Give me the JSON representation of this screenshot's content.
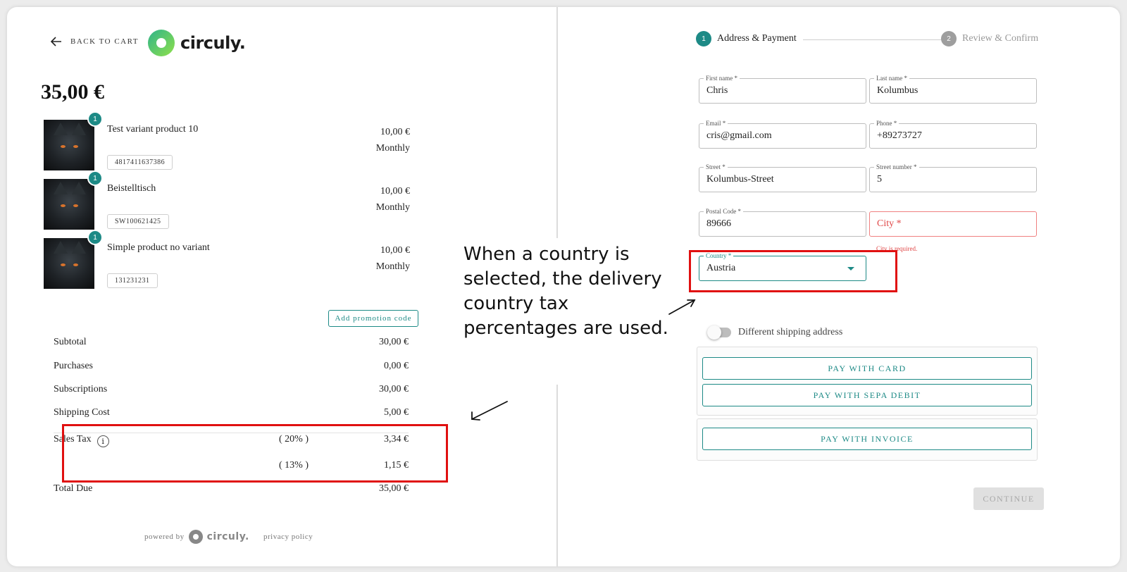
{
  "colors": {
    "accent": "#1d8a86",
    "error": "#e04848",
    "highlight": "#e01010"
  },
  "header": {
    "back_label": "BACK TO CART",
    "logo_text": "circuly."
  },
  "cart": {
    "total": "35,00 €",
    "items": [
      {
        "qty": "1",
        "name": "Test variant product 10",
        "sku": "4817411637386",
        "price": "10,00 €",
        "interval": "Monthly"
      },
      {
        "qty": "1",
        "name": "Beistelltisch",
        "sku": "SW100621425",
        "price": "10,00 €",
        "interval": "Monthly"
      },
      {
        "qty": "1",
        "name": "Simple product no variant",
        "sku": "131231231",
        "price": "10,00 €",
        "interval": "Monthly"
      }
    ],
    "promo_label": "Add promotion code"
  },
  "summary": {
    "subtotal": {
      "label": "Subtotal",
      "value": "30,00 €"
    },
    "purchases": {
      "label": "Purchases",
      "value": "0,00 €"
    },
    "subscriptions": {
      "label": "Subscriptions",
      "value": "30,00 €"
    },
    "shipping": {
      "label": "Shipping Cost",
      "value": "5,00 €"
    },
    "sales_tax": {
      "label": "Sales Tax",
      "info_icon": "i",
      "rates": [
        {
          "pct": "( 20% )",
          "value": "3,34 €"
        },
        {
          "pct": "( 13% )",
          "value": "1,15 €"
        }
      ]
    },
    "total_due": {
      "label": "Total Due",
      "value": "35,00 €"
    }
  },
  "footer": {
    "powered_by": "powered by",
    "logo_text": "circuly.",
    "privacy": "privacy policy"
  },
  "annotation": {
    "text": "When a country is selected, the delivery country tax percentages are used."
  },
  "stepper": [
    {
      "num": "1",
      "label": "Address & Payment",
      "active": true
    },
    {
      "num": "2",
      "label": "Review & Confirm",
      "active": false
    }
  ],
  "form": {
    "first_name": {
      "label": "First name *",
      "value": "Chris"
    },
    "last_name": {
      "label": "Last name *",
      "value": "Kolumbus"
    },
    "email": {
      "label": "Email *",
      "value": "cris@gmail.com"
    },
    "phone": {
      "label": "Phone *",
      "value": "+89273727"
    },
    "street": {
      "label": "Street *",
      "value": "Kolumbus-Street"
    },
    "street_number": {
      "label": "Street number *",
      "value": "5"
    },
    "postal_code": {
      "label": "Postal Code *",
      "value": "89666"
    },
    "city": {
      "placeholder": "City *",
      "error": "City is required."
    },
    "country": {
      "label": "Country *",
      "value": "Austria"
    },
    "shipping_toggle": "Different shipping address"
  },
  "payment": {
    "card": "PAY WITH CARD",
    "sepa": "PAY WITH SEPA DEBIT",
    "invoice": "PAY WITH INVOICE"
  },
  "continue_label": "CONTINUE"
}
